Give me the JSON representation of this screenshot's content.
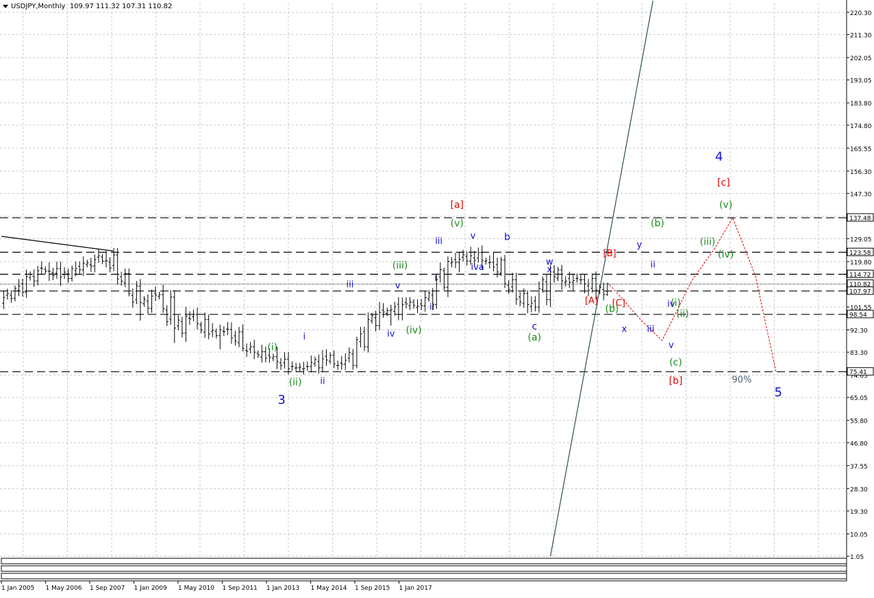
{
  "header": {
    "symbol": "USDJPY,Monthly",
    "ohlc": "109.97 111.32 107.31 110.82"
  },
  "colors": {
    "grid": "#c8c8c8",
    "price_line": "#000000",
    "blue_wave": "#1010d0",
    "green_wave": "#1a8a1a",
    "red_wave": "#e00000",
    "projection": "#d00000",
    "trendline": "#2f4f4f",
    "label_box_bg": "#ffffff",
    "label_box_border": "#000000",
    "gray_text": "#556677"
  },
  "chart_data": {
    "type": "ohlc",
    "title": "USDJPY,Monthly",
    "y_axis": {
      "ticks": [
        "220.30",
        "211.30",
        "202.05",
        "193.05",
        "183.80",
        "174.80",
        "165.55",
        "156.30",
        "147.30",
        "138.05",
        "129.05",
        "119.80",
        "110.55",
        "101.55",
        "92.30",
        "83.30",
        "74.05",
        "65.05",
        "55.80",
        "46.80",
        "37.55",
        "28.30",
        "19.30",
        "10.05",
        "1.05"
      ],
      "range": [
        1.05,
        220.3
      ]
    },
    "x_axis": {
      "ticks": [
        "1 Jan 2005",
        "1 May 2006",
        "1 Sep 2007",
        "1 Jan 2009",
        "1 May 2010",
        "1 Sep 2011",
        "1 Jan 2013",
        "1 May 2014",
        "1 Sep 2015",
        "1 Jan 2017"
      ]
    },
    "horizontal_levels": [
      {
        "label": "137.48",
        "value": 137.48,
        "style": "dashed"
      },
      {
        "label": "123.58",
        "value": 123.58,
        "style": "dashed"
      },
      {
        "label": "114.72",
        "value": 114.72,
        "style": "dashed"
      },
      {
        "label": "110.82",
        "value": 110.82,
        "style": "solid-current"
      },
      {
        "label": "107.97",
        "value": 107.97,
        "style": "dashed"
      },
      {
        "label": "98.54",
        "value": 98.54,
        "style": "dashed"
      },
      {
        "label": "75.41",
        "value": 75.41,
        "style": "dashed"
      }
    ],
    "price_series": [
      {
        "t": 2005.0,
        "o": 103.0,
        "h": 106.5,
        "l": 102.0,
        "c": 105.0
      },
      {
        "t": 2005.25,
        "o": 105.0,
        "h": 108.5,
        "l": 104.0,
        "c": 107.5
      },
      {
        "t": 2005.5,
        "o": 107.5,
        "h": 113.0,
        "l": 106.5,
        "c": 112.0
      },
      {
        "t": 2005.75,
        "o": 112.0,
        "h": 117.5,
        "l": 110.5,
        "c": 116.0
      },
      {
        "t": 2006.0,
        "o": 116.0,
        "h": 119.5,
        "l": 112.0,
        "c": 117.0
      },
      {
        "t": 2006.25,
        "o": 117.0,
        "h": 118.0,
        "l": 110.0,
        "c": 113.0
      },
      {
        "t": 2006.5,
        "o": 113.0,
        "h": 117.5,
        "l": 112.0,
        "c": 116.5
      },
      {
        "t": 2006.75,
        "o": 116.5,
        "h": 119.5,
        "l": 114.0,
        "c": 118.0
      },
      {
        "t": 2007.0,
        "o": 118.0,
        "h": 121.5,
        "l": 115.5,
        "c": 120.0
      },
      {
        "t": 2007.25,
        "o": 120.0,
        "h": 124.1,
        "l": 117.5,
        "c": 122.5
      },
      {
        "t": 2007.5,
        "o": 122.5,
        "h": 123.5,
        "l": 111.5,
        "c": 115.0
      },
      {
        "t": 2007.75,
        "o": 115.0,
        "h": 117.0,
        "l": 107.0,
        "c": 110.0
      },
      {
        "t": 2008.0,
        "o": 110.0,
        "h": 110.5,
        "l": 96.0,
        "c": 101.0
      },
      {
        "t": 2008.25,
        "o": 101.0,
        "h": 108.5,
        "l": 100.0,
        "c": 106.5
      },
      {
        "t": 2008.5,
        "o": 106.5,
        "h": 110.5,
        "l": 103.5,
        "c": 105.5
      },
      {
        "t": 2008.75,
        "o": 105.5,
        "h": 106.0,
        "l": 87.0,
        "c": 91.0
      },
      {
        "t": 2009.0,
        "o": 91.0,
        "h": 101.5,
        "l": 87.5,
        "c": 98.5
      },
      {
        "t": 2009.25,
        "o": 98.5,
        "h": 100.5,
        "l": 93.0,
        "c": 96.5
      },
      {
        "t": 2009.5,
        "o": 96.5,
        "h": 97.5,
        "l": 88.5,
        "c": 90.0
      },
      {
        "t": 2009.75,
        "o": 90.0,
        "h": 93.5,
        "l": 84.5,
        "c": 92.5
      },
      {
        "t": 2010.0,
        "o": 92.5,
        "h": 95.0,
        "l": 88.0,
        "c": 91.5
      },
      {
        "t": 2010.25,
        "o": 91.5,
        "h": 94.5,
        "l": 84.5,
        "c": 85.5
      },
      {
        "t": 2010.5,
        "o": 85.5,
        "h": 86.5,
        "l": 80.5,
        "c": 83.5
      },
      {
        "t": 2010.75,
        "o": 83.5,
        "h": 84.5,
        "l": 80.0,
        "c": 81.5
      },
      {
        "t": 2011.0,
        "o": 81.5,
        "h": 85.5,
        "l": 76.5,
        "c": 80.5
      },
      {
        "t": 2011.25,
        "o": 80.5,
        "h": 81.5,
        "l": 76.0,
        "c": 77.0
      },
      {
        "t": 2011.5,
        "o": 77.0,
        "h": 79.0,
        "l": 75.5,
        "c": 77.5
      },
      {
        "t": 2011.75,
        "o": 77.5,
        "h": 78.5,
        "l": 75.8,
        "c": 77.0
      },
      {
        "t": 2012.0,
        "o": 77.0,
        "h": 84.2,
        "l": 76.0,
        "c": 82.0
      },
      {
        "t": 2012.25,
        "o": 82.0,
        "h": 82.5,
        "l": 77.5,
        "c": 78.5
      },
      {
        "t": 2012.5,
        "o": 78.5,
        "h": 80.0,
        "l": 77.0,
        "c": 78.0
      },
      {
        "t": 2012.75,
        "o": 78.0,
        "h": 86.5,
        "l": 77.5,
        "c": 85.5
      },
      {
        "t": 2013.0,
        "o": 85.5,
        "h": 96.5,
        "l": 85.0,
        "c": 94.0
      },
      {
        "t": 2013.25,
        "o": 94.0,
        "h": 103.5,
        "l": 93.0,
        "c": 100.0
      },
      {
        "t": 2013.5,
        "o": 100.0,
        "h": 101.5,
        "l": 94.0,
        "c": 98.5
      },
      {
        "t": 2013.75,
        "o": 98.5,
        "h": 105.0,
        "l": 96.5,
        "c": 103.5
      },
      {
        "t": 2014.0,
        "o": 103.5,
        "h": 104.5,
        "l": 100.8,
        "c": 102.0
      },
      {
        "t": 2014.25,
        "o": 102.0,
        "h": 104.0,
        "l": 101.0,
        "c": 102.5
      },
      {
        "t": 2014.5,
        "o": 102.5,
        "h": 110.0,
        "l": 101.5,
        "c": 109.5
      },
      {
        "t": 2014.75,
        "o": 109.5,
        "h": 121.5,
        "l": 105.5,
        "c": 119.5
      },
      {
        "t": 2015.0,
        "o": 119.5,
        "h": 122.0,
        "l": 115.5,
        "c": 120.0
      },
      {
        "t": 2015.25,
        "o": 120.0,
        "h": 125.8,
        "l": 118.5,
        "c": 123.5
      },
      {
        "t": 2015.5,
        "o": 123.5,
        "h": 125.0,
        "l": 116.5,
        "c": 119.5
      },
      {
        "t": 2015.75,
        "o": 119.5,
        "h": 123.5,
        "l": 118.0,
        "c": 120.5
      },
      {
        "t": 2016.0,
        "o": 120.5,
        "h": 121.5,
        "l": 110.0,
        "c": 112.5
      },
      {
        "t": 2016.25,
        "o": 112.5,
        "h": 114.0,
        "l": 105.5,
        "c": 107.0
      },
      {
        "t": 2016.5,
        "o": 107.0,
        "h": 107.5,
        "l": 99.0,
        "c": 101.5
      },
      {
        "t": 2016.75,
        "o": 101.5,
        "h": 105.5,
        "l": 100.0,
        "c": 104.5
      },
      {
        "t": 2017.0,
        "o": 104.5,
        "h": 118.5,
        "l": 101.5,
        "c": 116.5
      },
      {
        "t": 2017.25,
        "o": 116.5,
        "h": 117.5,
        "l": 108.5,
        "c": 111.5
      },
      {
        "t": 2017.5,
        "o": 111.5,
        "h": 114.5,
        "l": 108.0,
        "c": 112.5
      },
      {
        "t": 2017.75,
        "o": 112.5,
        "h": 114.7,
        "l": 107.0,
        "c": 113.0
      },
      {
        "t": 2018.0,
        "o": 113.0,
        "h": 113.5,
        "l": 104.6,
        "c": 106.5
      },
      {
        "t": 2018.25,
        "o": 106.5,
        "h": 111.3,
        "l": 106.0,
        "c": 110.8
      }
    ],
    "annotations": [
      {
        "text": "[a]",
        "color": "red",
        "t": 2014.95,
        "v": 141.5,
        "size": 14
      },
      {
        "text": "(v)",
        "color": "green",
        "t": 2014.95,
        "v": 134.0,
        "size": 14
      },
      {
        "text": "iii",
        "color": "blue",
        "t": 2014.55,
        "v": 127.0,
        "size": 13
      },
      {
        "text": "v",
        "color": "blue",
        "t": 2015.3,
        "v": 129.0,
        "size": 13
      },
      {
        "text": "b",
        "color": "blue",
        "t": 2016.05,
        "v": 128.5,
        "size": 14
      },
      {
        "text": "iva",
        "color": "blue",
        "t": 2015.4,
        "v": 116.5,
        "size": 13
      },
      {
        "text": "i",
        "color": "blue",
        "t": 2014.48,
        "v": 112.0,
        "size": 13
      },
      {
        "text": "ii",
        "color": "blue",
        "t": 2014.4,
        "v": 100.5,
        "size": 13
      },
      {
        "text": "iii",
        "color": "blue",
        "t": 2012.6,
        "v": 109.5,
        "size": 13
      },
      {
        "text": "v",
        "color": "blue",
        "t": 2013.65,
        "v": 109.0,
        "size": 13
      },
      {
        "text": "(iii)",
        "color": "green",
        "t": 2013.7,
        "v": 117.0,
        "size": 14
      },
      {
        "text": "iv",
        "color": "blue",
        "t": 2013.5,
        "v": 89.5,
        "size": 13
      },
      {
        "text": "(iv)",
        "color": "green",
        "t": 2014.0,
        "v": 91.0,
        "size": 14
      },
      {
        "text": "c",
        "color": "blue",
        "t": 2016.65,
        "v": 92.5,
        "size": 14
      },
      {
        "text": "(a)",
        "color": "green",
        "t": 2016.65,
        "v": 88.0,
        "size": 14
      },
      {
        "text": "i",
        "color": "blue",
        "t": 2011.6,
        "v": 88.5,
        "size": 13
      },
      {
        "text": "(i)",
        "color": "green",
        "t": 2010.9,
        "v": 84.0,
        "size": 14
      },
      {
        "text": "ii",
        "color": "blue",
        "t": 2012.0,
        "v": 70.5,
        "size": 13
      },
      {
        "text": "(ii)",
        "color": "green",
        "t": 2011.4,
        "v": 70.0,
        "size": 14
      },
      {
        "text": "3",
        "color": "blue",
        "t": 2011.1,
        "v": 62.5,
        "size": 18
      },
      {
        "text": "4",
        "color": "blue",
        "t": 2020.7,
        "v": 160.5,
        "size": 18
      },
      {
        "text": "[c]",
        "color": "red",
        "t": 2020.8,
        "v": 150.5,
        "size": 14
      },
      {
        "text": "(v)",
        "color": "green",
        "t": 2020.85,
        "v": 141.5,
        "size": 14
      },
      {
        "text": "(b)",
        "color": "green",
        "t": 2019.35,
        "v": 134.0,
        "size": 14
      },
      {
        "text": "(iii)",
        "color": "green",
        "t": 2020.45,
        "v": 126.5,
        "size": 14
      },
      {
        "text": "(iv)",
        "color": "green",
        "t": 2020.85,
        "v": 121.5,
        "size": 14
      },
      {
        "text": "y",
        "color": "blue",
        "t": 2018.95,
        "v": 125.5,
        "size": 13
      },
      {
        "text": "w",
        "color": "blue",
        "t": 2016.98,
        "v": 118.5,
        "size": 13
      },
      {
        "text": "x",
        "color": "blue",
        "t": 2016.98,
        "v": 115.5,
        "size": 13
      },
      {
        "text": "ii",
        "color": "blue",
        "t": 2019.25,
        "v": 117.5,
        "size": 13
      },
      {
        "text": "[B]",
        "color": "red",
        "t": 2018.3,
        "v": 122.0,
        "size": 13
      },
      {
        "text": "[A]",
        "color": "red",
        "t": 2017.9,
        "v": 103.0,
        "size": 13
      },
      {
        "text": "[C]",
        "color": "red",
        "t": 2018.5,
        "v": 102.0,
        "size": 13
      },
      {
        "text": "(b)",
        "color": "green",
        "t": 2018.35,
        "v": 99.5,
        "size": 14
      },
      {
        "text": "iv",
        "color": "blue",
        "t": 2019.65,
        "v": 101.5,
        "size": 13
      },
      {
        "text": "(i)",
        "color": "green",
        "t": 2019.75,
        "v": 102.0,
        "size": 14
      },
      {
        "text": "(ii)",
        "color": "green",
        "t": 2019.9,
        "v": 97.5,
        "size": 14
      },
      {
        "text": "x",
        "color": "blue",
        "t": 2018.62,
        "v": 91.5,
        "size": 13
      },
      {
        "text": "iii",
        "color": "blue",
        "t": 2019.2,
        "v": 91.5,
        "size": 13
      },
      {
        "text": "v",
        "color": "blue",
        "t": 2019.65,
        "v": 85.0,
        "size": 13
      },
      {
        "text": "(c)",
        "color": "green",
        "t": 2019.75,
        "v": 78.0,
        "size": 14
      },
      {
        "text": "[b]",
        "color": "red",
        "t": 2019.75,
        "v": 70.5,
        "size": 14
      },
      {
        "text": "90%",
        "color": "gray",
        "t": 2021.2,
        "v": 71.0,
        "size": 13
      },
      {
        "text": "5",
        "color": "blue",
        "t": 2022.0,
        "v": 65.5,
        "size": 18
      }
    ],
    "projection_path": [
      {
        "t": 2018.3,
        "v": 110.5
      },
      {
        "t": 2019.0,
        "v": 96.0
      },
      {
        "t": 2019.45,
        "v": 88.0
      },
      {
        "t": 2020.1,
        "v": 112.0
      },
      {
        "t": 2020.6,
        "v": 125.0
      },
      {
        "t": 2021.0,
        "v": 137.5
      },
      {
        "t": 2021.5,
        "v": 114.0
      },
      {
        "t": 2021.95,
        "v": 75.41
      }
    ],
    "trendlines": [
      {
        "points": [
          {
            "t": 2004.95,
            "v": 130.0
          },
          {
            "t": 2007.4,
            "v": 124.1
          }
        ],
        "color": "black"
      },
      {
        "points": [
          {
            "t": 2017.0,
            "v": 1.05
          },
          {
            "t": 2019.25,
            "v": 225.0
          }
        ],
        "color": "steel"
      }
    ],
    "grid": true
  }
}
